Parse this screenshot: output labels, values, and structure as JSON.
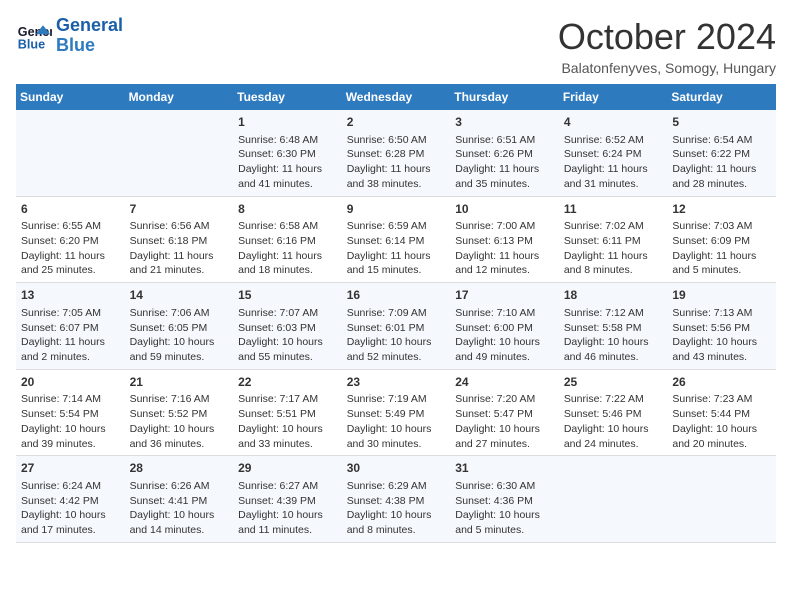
{
  "header": {
    "logo_line1": "General",
    "logo_line2": "Blue",
    "month": "October 2024",
    "location": "Balatonfenyves, Somogy, Hungary"
  },
  "weekdays": [
    "Sunday",
    "Monday",
    "Tuesday",
    "Wednesday",
    "Thursday",
    "Friday",
    "Saturday"
  ],
  "weeks": [
    [
      {
        "day": "",
        "detail": ""
      },
      {
        "day": "",
        "detail": ""
      },
      {
        "day": "1",
        "detail": "Sunrise: 6:48 AM\nSunset: 6:30 PM\nDaylight: 11 hours and 41 minutes."
      },
      {
        "day": "2",
        "detail": "Sunrise: 6:50 AM\nSunset: 6:28 PM\nDaylight: 11 hours and 38 minutes."
      },
      {
        "day": "3",
        "detail": "Sunrise: 6:51 AM\nSunset: 6:26 PM\nDaylight: 11 hours and 35 minutes."
      },
      {
        "day": "4",
        "detail": "Sunrise: 6:52 AM\nSunset: 6:24 PM\nDaylight: 11 hours and 31 minutes."
      },
      {
        "day": "5",
        "detail": "Sunrise: 6:54 AM\nSunset: 6:22 PM\nDaylight: 11 hours and 28 minutes."
      }
    ],
    [
      {
        "day": "6",
        "detail": "Sunrise: 6:55 AM\nSunset: 6:20 PM\nDaylight: 11 hours and 25 minutes."
      },
      {
        "day": "7",
        "detail": "Sunrise: 6:56 AM\nSunset: 6:18 PM\nDaylight: 11 hours and 21 minutes."
      },
      {
        "day": "8",
        "detail": "Sunrise: 6:58 AM\nSunset: 6:16 PM\nDaylight: 11 hours and 18 minutes."
      },
      {
        "day": "9",
        "detail": "Sunrise: 6:59 AM\nSunset: 6:14 PM\nDaylight: 11 hours and 15 minutes."
      },
      {
        "day": "10",
        "detail": "Sunrise: 7:00 AM\nSunset: 6:13 PM\nDaylight: 11 hours and 12 minutes."
      },
      {
        "day": "11",
        "detail": "Sunrise: 7:02 AM\nSunset: 6:11 PM\nDaylight: 11 hours and 8 minutes."
      },
      {
        "day": "12",
        "detail": "Sunrise: 7:03 AM\nSunset: 6:09 PM\nDaylight: 11 hours and 5 minutes."
      }
    ],
    [
      {
        "day": "13",
        "detail": "Sunrise: 7:05 AM\nSunset: 6:07 PM\nDaylight: 11 hours and 2 minutes."
      },
      {
        "day": "14",
        "detail": "Sunrise: 7:06 AM\nSunset: 6:05 PM\nDaylight: 10 hours and 59 minutes."
      },
      {
        "day": "15",
        "detail": "Sunrise: 7:07 AM\nSunset: 6:03 PM\nDaylight: 10 hours and 55 minutes."
      },
      {
        "day": "16",
        "detail": "Sunrise: 7:09 AM\nSunset: 6:01 PM\nDaylight: 10 hours and 52 minutes."
      },
      {
        "day": "17",
        "detail": "Sunrise: 7:10 AM\nSunset: 6:00 PM\nDaylight: 10 hours and 49 minutes."
      },
      {
        "day": "18",
        "detail": "Sunrise: 7:12 AM\nSunset: 5:58 PM\nDaylight: 10 hours and 46 minutes."
      },
      {
        "day": "19",
        "detail": "Sunrise: 7:13 AM\nSunset: 5:56 PM\nDaylight: 10 hours and 43 minutes."
      }
    ],
    [
      {
        "day": "20",
        "detail": "Sunrise: 7:14 AM\nSunset: 5:54 PM\nDaylight: 10 hours and 39 minutes."
      },
      {
        "day": "21",
        "detail": "Sunrise: 7:16 AM\nSunset: 5:52 PM\nDaylight: 10 hours and 36 minutes."
      },
      {
        "day": "22",
        "detail": "Sunrise: 7:17 AM\nSunset: 5:51 PM\nDaylight: 10 hours and 33 minutes."
      },
      {
        "day": "23",
        "detail": "Sunrise: 7:19 AM\nSunset: 5:49 PM\nDaylight: 10 hours and 30 minutes."
      },
      {
        "day": "24",
        "detail": "Sunrise: 7:20 AM\nSunset: 5:47 PM\nDaylight: 10 hours and 27 minutes."
      },
      {
        "day": "25",
        "detail": "Sunrise: 7:22 AM\nSunset: 5:46 PM\nDaylight: 10 hours and 24 minutes."
      },
      {
        "day": "26",
        "detail": "Sunrise: 7:23 AM\nSunset: 5:44 PM\nDaylight: 10 hours and 20 minutes."
      }
    ],
    [
      {
        "day": "27",
        "detail": "Sunrise: 6:24 AM\nSunset: 4:42 PM\nDaylight: 10 hours and 17 minutes."
      },
      {
        "day": "28",
        "detail": "Sunrise: 6:26 AM\nSunset: 4:41 PM\nDaylight: 10 hours and 14 minutes."
      },
      {
        "day": "29",
        "detail": "Sunrise: 6:27 AM\nSunset: 4:39 PM\nDaylight: 10 hours and 11 minutes."
      },
      {
        "day": "30",
        "detail": "Sunrise: 6:29 AM\nSunset: 4:38 PM\nDaylight: 10 hours and 8 minutes."
      },
      {
        "day": "31",
        "detail": "Sunrise: 6:30 AM\nSunset: 4:36 PM\nDaylight: 10 hours and 5 minutes."
      },
      {
        "day": "",
        "detail": ""
      },
      {
        "day": "",
        "detail": ""
      }
    ]
  ]
}
